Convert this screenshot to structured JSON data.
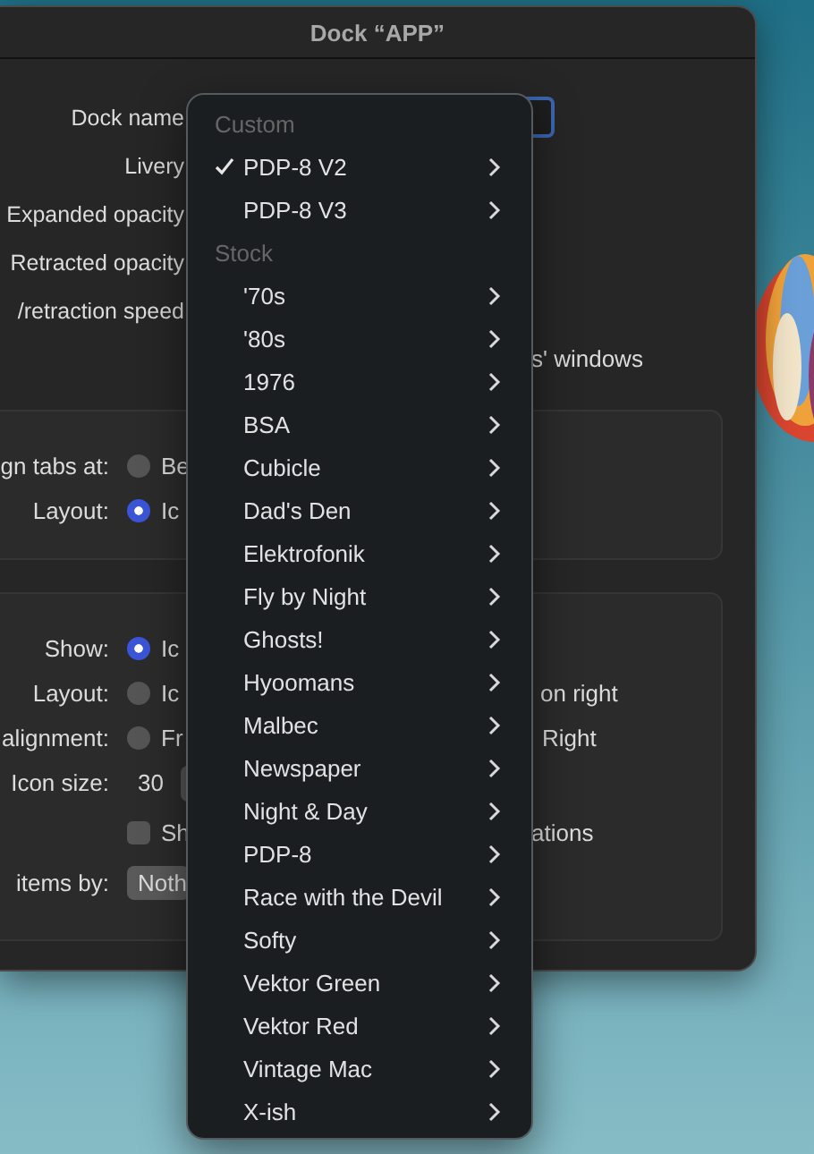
{
  "window": {
    "title": "Dock “APP”"
  },
  "settings": [
    {
      "kind": "field",
      "label": "Dock name"
    },
    {
      "kind": "label",
      "label": "Livery"
    },
    {
      "kind": "label",
      "label": "Expanded opacity"
    },
    {
      "kind": "label",
      "label": "Retracted opacity"
    },
    {
      "kind": "label",
      "label": "/retraction speed"
    },
    {
      "kind": "note",
      "text": "s' windows"
    }
  ],
  "tabs_group": [
    {
      "kind": "radio",
      "label": "gn tabs at:",
      "selected": false,
      "option": "Be"
    },
    {
      "kind": "radio",
      "label": "Layout:",
      "selected": true,
      "option": "Ic"
    }
  ],
  "items_group": [
    {
      "kind": "radio",
      "label": "Show:",
      "selected": true,
      "option": "Ic"
    },
    {
      "kind": "radio",
      "label": "Layout:",
      "selected": false,
      "option": "Ic",
      "extra": "on right"
    },
    {
      "kind": "radio",
      "label": "alignment:",
      "selected": false,
      "option": "Fr",
      "extra": "Right"
    },
    {
      "kind": "stepper",
      "label": "Icon size:",
      "value": "30"
    },
    {
      "kind": "checkbox",
      "checked": false,
      "option": "Sh",
      "extra": "ations"
    },
    {
      "kind": "popup",
      "label": "items by:",
      "value": "Noth"
    }
  ],
  "menu": {
    "sections": [
      {
        "header": "Custom",
        "items": [
          {
            "label": "PDP-8 V2",
            "checked": true
          },
          {
            "label": "PDP-8 V3",
            "checked": false
          }
        ]
      },
      {
        "header": "Stock",
        "items": [
          {
            "label": "'70s",
            "checked": false
          },
          {
            "label": "'80s",
            "checked": false
          },
          {
            "label": "1976",
            "checked": false
          },
          {
            "label": "BSA",
            "checked": false
          },
          {
            "label": "Cubicle",
            "checked": false
          },
          {
            "label": "Dad's Den",
            "checked": false
          },
          {
            "label": "Elektrofonik",
            "checked": false
          },
          {
            "label": "Fly by Night",
            "checked": false
          },
          {
            "label": "Ghosts!",
            "checked": false
          },
          {
            "label": "Hyoomans",
            "checked": false
          },
          {
            "label": "Malbec",
            "checked": false
          },
          {
            "label": "Newspaper",
            "checked": false
          },
          {
            "label": "Night & Day",
            "checked": false
          },
          {
            "label": "PDP-8",
            "checked": false
          },
          {
            "label": "Race with the Devil",
            "checked": false
          },
          {
            "label": "Softy",
            "checked": false
          },
          {
            "label": "Vektor Green",
            "checked": false
          },
          {
            "label": "Vektor Red",
            "checked": false
          },
          {
            "label": "Vintage Mac",
            "checked": false
          },
          {
            "label": "X-ish",
            "checked": false
          }
        ]
      }
    ]
  }
}
